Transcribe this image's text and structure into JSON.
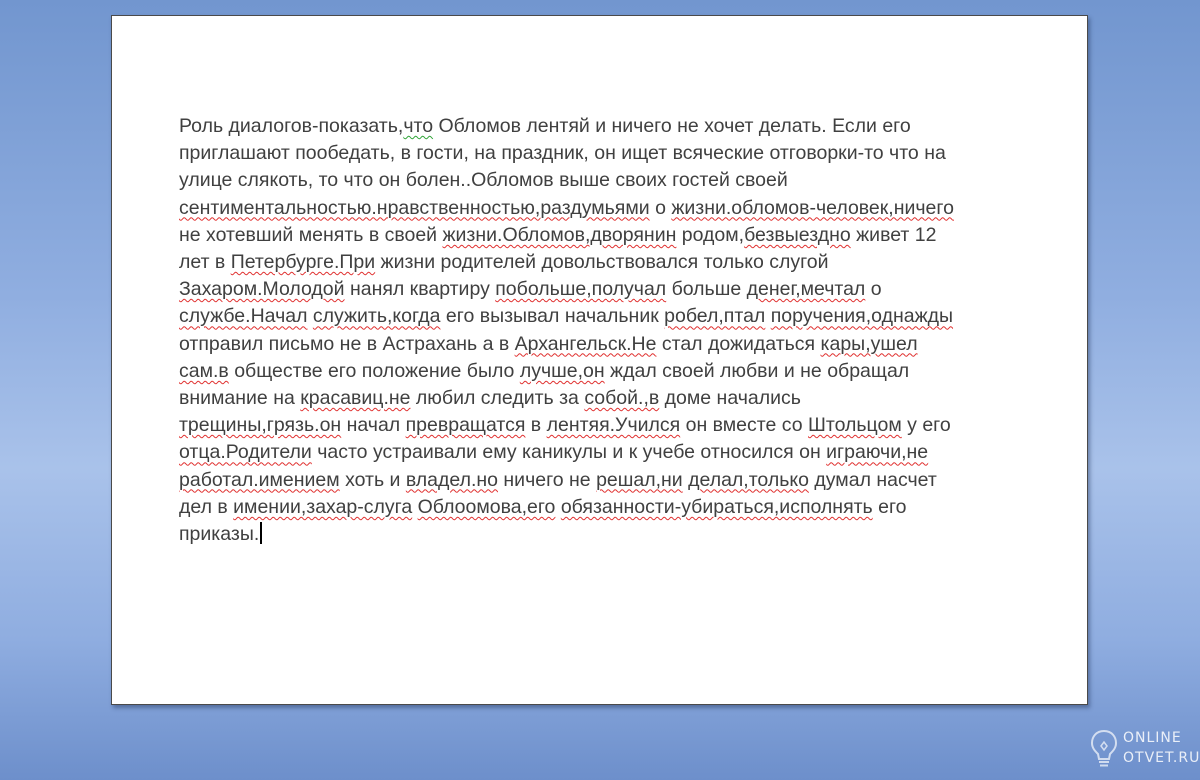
{
  "document": {
    "lines": [
      [
        {
          "t": "Роль диалогов-показать,"
        },
        {
          "t": "что",
          "s": "gram"
        },
        {
          "t": " Обломов лентяй и ничего не хочет делать. Если его"
        }
      ],
      [
        {
          "t": "приглашают пообедать, в гости, на праздник, он ищет всяческие отговорки-то что на"
        }
      ],
      [
        {
          "t": "улице слякоть, то что он болен..Обломов выше своих гостей своей"
        }
      ],
      [
        {
          "t": "сентиментальностью.нравственностью,раздумьями",
          "s": "err"
        },
        {
          "t": " о "
        },
        {
          "t": "жизни.обломов-человек,ничего",
          "s": "err"
        }
      ],
      [
        {
          "t": "не хотевший менять в своей "
        },
        {
          "t": "жизни.Обломов,дворянин",
          "s": "err"
        },
        {
          "t": " родом,"
        },
        {
          "t": "безвыездно",
          "s": "err"
        },
        {
          "t": " живет 12"
        }
      ],
      [
        {
          "t": "лет в "
        },
        {
          "t": "Петербурге.При",
          "s": "err"
        },
        {
          "t": " жизни родителей довольствовался только слугой"
        }
      ],
      [
        {
          "t": "Захаром.Молодой",
          "s": "err"
        },
        {
          "t": " нанял квартиру "
        },
        {
          "t": "побольше,получал",
          "s": "err"
        },
        {
          "t": " больше "
        },
        {
          "t": "денег,мечтал",
          "s": "err"
        },
        {
          "t": " о"
        }
      ],
      [
        {
          "t": "службе.Начал",
          "s": "err"
        },
        {
          "t": " "
        },
        {
          "t": "служить,когда",
          "s": "err"
        },
        {
          "t": " его вызывал начальник "
        },
        {
          "t": "робел,птал",
          "s": "err"
        },
        {
          "t": " "
        },
        {
          "t": "поручения,однажды",
          "s": "err"
        }
      ],
      [
        {
          "t": "отправил письмо не в Астрахань а в "
        },
        {
          "t": "Архангельск.Не",
          "s": "err"
        },
        {
          "t": " стал дожидаться "
        },
        {
          "t": "кары,ушел",
          "s": "err"
        }
      ],
      [
        {
          "t": "сам.в",
          "s": "err"
        },
        {
          "t": " обществе его положение было "
        },
        {
          "t": "лучше,он",
          "s": "err"
        },
        {
          "t": " ждал своей любви и не обращал"
        }
      ],
      [
        {
          "t": "внимание на "
        },
        {
          "t": "красавиц.не",
          "s": "err"
        },
        {
          "t": " любил следить за "
        },
        {
          "t": "собой.,в",
          "s": "err"
        },
        {
          "t": " доме начались"
        }
      ],
      [
        {
          "t": "трещины,грязь.он",
          "s": "err"
        },
        {
          "t": " начал "
        },
        {
          "t": "превращатся",
          "s": "err"
        },
        {
          "t": " в "
        },
        {
          "t": "лентяя.Учился",
          "s": "err"
        },
        {
          "t": " он вместе со "
        },
        {
          "t": "Штольцом",
          "s": "err"
        },
        {
          "t": " у его"
        }
      ],
      [
        {
          "t": "отца.Родители",
          "s": "err"
        },
        {
          "t": " часто устраивали ему каникулы и к учебе относился он "
        },
        {
          "t": "играючи,не",
          "s": "err"
        }
      ],
      [
        {
          "t": "работал.имением",
          "s": "err"
        },
        {
          "t": " хоть и "
        },
        {
          "t": "владел.но",
          "s": "err"
        },
        {
          "t": " ничего не "
        },
        {
          "t": "решал,ни",
          "s": "err"
        },
        {
          "t": " "
        },
        {
          "t": "делал,только",
          "s": "err"
        },
        {
          "t": " думал насчет"
        }
      ],
      [
        {
          "t": "дел в "
        },
        {
          "t": "имении,захар-слуга",
          "s": "err"
        },
        {
          "t": " "
        },
        {
          "t": "Облоомова,его",
          "s": "err"
        },
        {
          "t": " "
        },
        {
          "t": "обязанности-убираться,исполнять",
          "s": "err"
        },
        {
          "t": " его"
        }
      ],
      [
        {
          "t": "приказы."
        }
      ]
    ]
  },
  "watermark": {
    "line1": "ONLINE",
    "line2": "OTVET.RU",
    "icon": "lightbulb-icon"
  }
}
